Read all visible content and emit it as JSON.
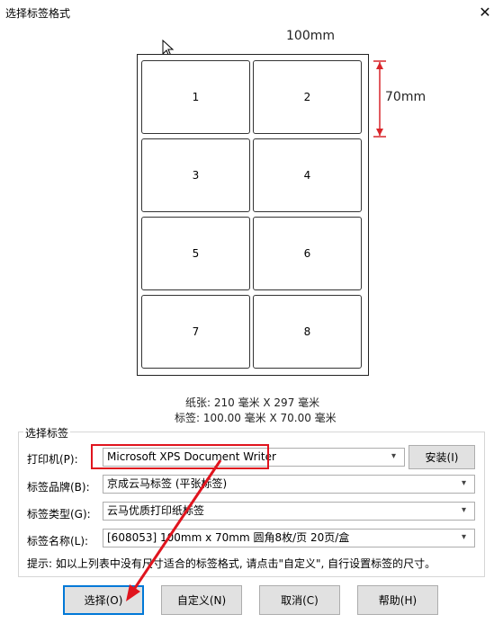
{
  "window": {
    "title": "选择标签格式"
  },
  "preview": {
    "width_label": "100mm",
    "height_label": "70mm",
    "labels": [
      "1",
      "2",
      "3",
      "4",
      "5",
      "6",
      "7",
      "8"
    ],
    "paper_info": "纸张:  210 毫米 X  297 毫米",
    "label_info": "标签:  100.00 毫米 X 70.00 毫米"
  },
  "group": {
    "title": "选择标签",
    "printer_label": "打印机(P):",
    "printer_value": "Microsoft XPS Document Writer",
    "install_button": "安装(I)",
    "brand_label": "标签品牌(B):",
    "brand_value": "京成云马标签 (平张标签)",
    "type_label": "标签类型(G):",
    "type_value": "云马优质打印纸标签",
    "name_label": "标签名称(L):",
    "name_value": "[608053] 100mm x 70mm 圆角8枚/页 20页/盒",
    "hint": "提示: 如以上列表中没有尺寸适合的标签格式, 请点击\"自定义\", 自行设置标签的尺寸。"
  },
  "buttons": {
    "select": "选择(O)",
    "custom": "自定义(N)",
    "cancel": "取消(C)",
    "help": "帮助(H)"
  },
  "colors": {
    "highlight": "#e0141e",
    "accent": "#0078d7",
    "dimension_arrow": "#d9252a"
  }
}
